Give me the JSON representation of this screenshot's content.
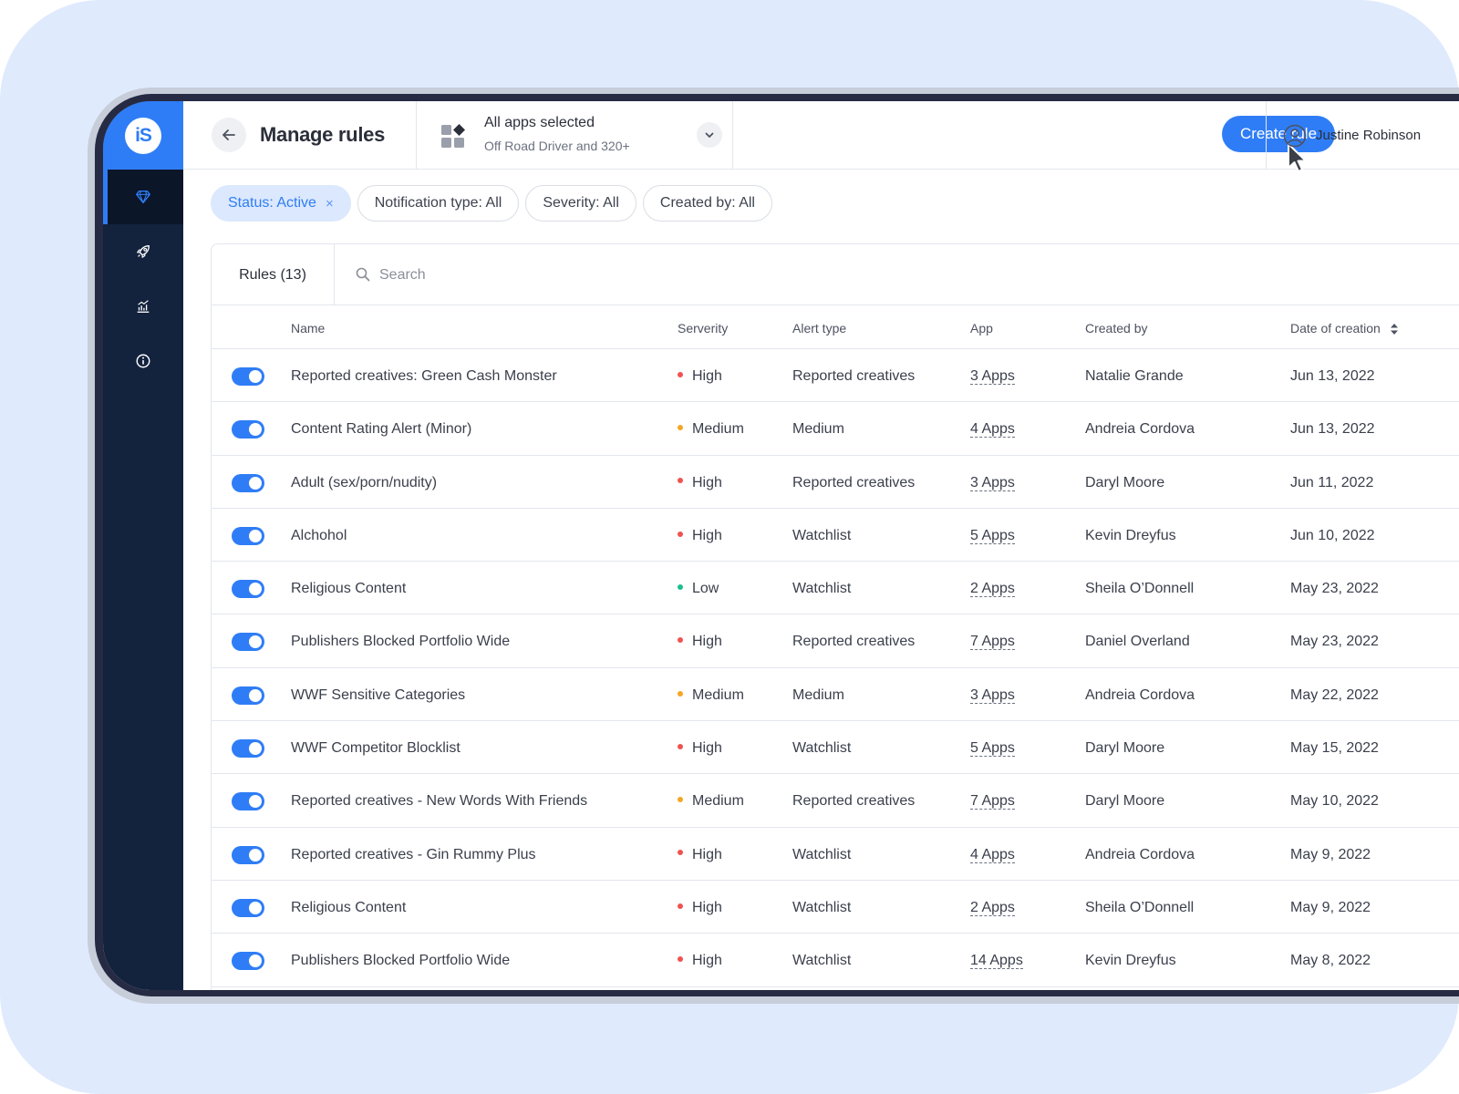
{
  "colors": {
    "accent": "#2f7df6",
    "sidebar": "#13223d",
    "severity_high": "#ef5350",
    "severity_medium": "#f5a623",
    "severity_low": "#1cbf8f"
  },
  "brand": {
    "logo_text": "iS"
  },
  "sidebar": {
    "items": [
      {
        "icon": "diamond-icon",
        "active": true
      },
      {
        "icon": "rocket-icon",
        "active": false
      },
      {
        "icon": "chart-icon",
        "active": false
      },
      {
        "icon": "info-icon",
        "active": false
      }
    ]
  },
  "header": {
    "title": "Manage rules",
    "app_select": {
      "title": "All apps selected",
      "subtitle": "Off Road Driver and 320+"
    },
    "create_label": "Create rule",
    "user_name": "Justine Robinson"
  },
  "filters": [
    {
      "label": "Status: Active",
      "active": true,
      "removable": true
    },
    {
      "label": "Notification type: All",
      "active": false,
      "removable": false
    },
    {
      "label": "Severity: All",
      "active": false,
      "removable": false
    },
    {
      "label": "Created by: All",
      "active": false,
      "removable": false
    }
  ],
  "filter_remove": "×",
  "table": {
    "tab_label": "Rules (13)",
    "search_placeholder": "Search",
    "columns": {
      "name": "Name",
      "severity": "Serverity",
      "alert_type": "Alert type",
      "app": "App",
      "created_by": "Created by",
      "date": "Date of creation"
    },
    "rows": [
      {
        "enabled": true,
        "name": "Reported creatives: Green Cash Monster",
        "severity": "High",
        "alert_type": "Reported creatives",
        "apps": "3 Apps",
        "created_by": "Natalie Grande",
        "date": "Jun 13, 2022"
      },
      {
        "enabled": true,
        "name": "Content Rating Alert (Minor)",
        "severity": "Medium",
        "alert_type": "Medium",
        "apps": "4 Apps",
        "created_by": "Andreia Cordova",
        "date": "Jun 13, 2022"
      },
      {
        "enabled": true,
        "name": "Adult (sex/porn/nudity)",
        "severity": "High",
        "alert_type": "Reported creatives",
        "apps": "3 Apps",
        "created_by": "Daryl Moore",
        "date": "Jun 11, 2022"
      },
      {
        "enabled": true,
        "name": "Alchohol",
        "severity": "High",
        "alert_type": "Watchlist",
        "apps": "5 Apps",
        "created_by": "Kevin Dreyfus",
        "date": "Jun 10, 2022"
      },
      {
        "enabled": true,
        "name": "Religious Content",
        "severity": "Low",
        "alert_type": "Watchlist",
        "apps": "2 Apps",
        "created_by": "Sheila O’Donnell",
        "date": "May 23, 2022"
      },
      {
        "enabled": true,
        "name": "Publishers Blocked Portfolio Wide",
        "severity": "High",
        "alert_type": "Reported creatives",
        "apps": "7 Apps",
        "created_by": "Daniel Overland",
        "date": "May 23, 2022"
      },
      {
        "enabled": true,
        "name": "WWF Sensitive Categories",
        "severity": "Medium",
        "alert_type": "Medium",
        "apps": "3 Apps",
        "created_by": "Andreia Cordova",
        "date": "May 22, 2022"
      },
      {
        "enabled": true,
        "name": "WWF Competitor Blocklist",
        "severity": "High",
        "alert_type": "Watchlist",
        "apps": "5 Apps",
        "created_by": "Daryl Moore",
        "date": "May 15, 2022"
      },
      {
        "enabled": true,
        "name": "Reported creatives - New Words With Friends",
        "severity": "Medium",
        "alert_type": "Reported creatives",
        "apps": "7 Apps",
        "created_by": "Daryl Moore",
        "date": "May 10, 2022"
      },
      {
        "enabled": true,
        "name": "Reported creatives - Gin Rummy Plus",
        "severity": "High",
        "alert_type": "Watchlist",
        "apps": "4 Apps",
        "created_by": "Andreia Cordova",
        "date": "May 9, 2022"
      },
      {
        "enabled": true,
        "name": "Religious Content",
        "severity": "High",
        "alert_type": "Watchlist",
        "apps": "2 Apps",
        "created_by": "Sheila O’Donnell",
        "date": "May 9, 2022"
      },
      {
        "enabled": true,
        "name": "Publishers Blocked Portfolio Wide",
        "severity": "High",
        "alert_type": "Watchlist",
        "apps": "14 Apps",
        "created_by": "Kevin Dreyfus",
        "date": "May 8, 2022"
      }
    ]
  }
}
